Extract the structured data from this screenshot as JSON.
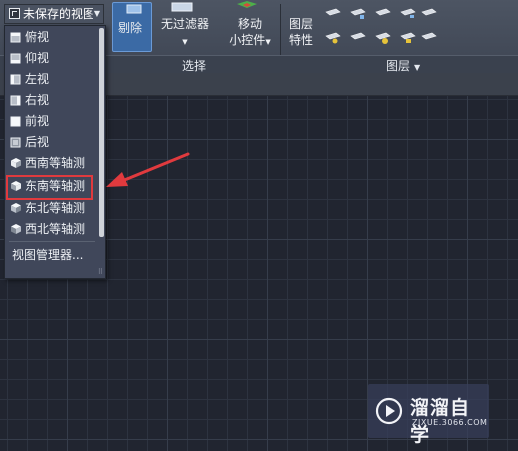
{
  "view_selector": {
    "current": "未保存的视图",
    "icon": "view-icon"
  },
  "view_menu": {
    "items": [
      {
        "label": "俯视",
        "icon": "top-view-icon"
      },
      {
        "label": "仰视",
        "icon": "bottom-view-icon"
      },
      {
        "label": "左视",
        "icon": "left-view-icon"
      },
      {
        "label": "右视",
        "icon": "right-view-icon"
      },
      {
        "label": "前视",
        "icon": "front-view-icon"
      },
      {
        "label": "后视",
        "icon": "back-view-icon"
      },
      {
        "label": "西南等轴测",
        "icon": "iso-sw-icon"
      },
      {
        "label": "东南等轴测",
        "icon": "iso-se-icon"
      },
      {
        "label": "东北等轴测",
        "icon": "iso-ne-icon"
      },
      {
        "label": "西北等轴测",
        "icon": "iso-nw-icon"
      }
    ],
    "manager_label": "视图管理器...",
    "highlighted": "东南等轴测"
  },
  "ribbon": {
    "exclude": "剔除",
    "no_filter": "无过滤器",
    "move_gizmo_line1": "移动",
    "move_gizmo_line2": "小控件",
    "layer_props_line1": "图层",
    "layer_props_line2": "特性",
    "panel_select": "选择",
    "panel_layers": "图层"
  },
  "watermark": {
    "title": "溜溜自学",
    "url": "ZIXUE.3066.COM"
  },
  "colors": {
    "highlight": "#e03a3e",
    "selected_button": "#3b6aa5",
    "canvas": "#212530"
  }
}
